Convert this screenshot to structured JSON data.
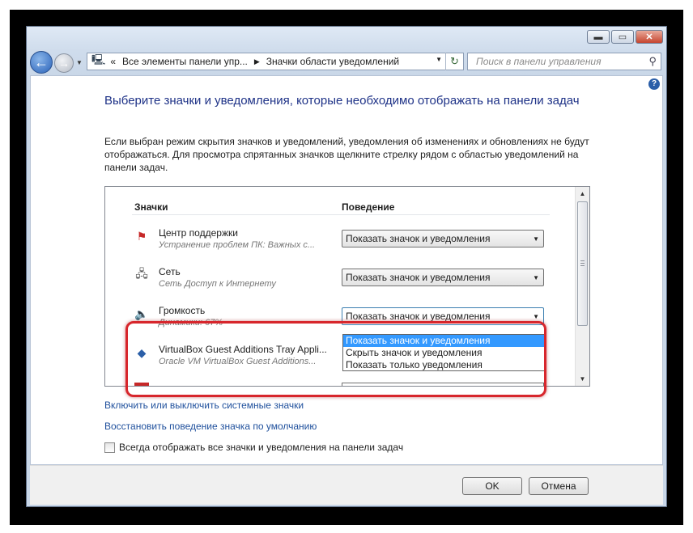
{
  "window": {
    "controls": {
      "minimize": "▬",
      "maximize": "▭",
      "close": "✕"
    }
  },
  "nav": {
    "back": "←",
    "forward": "→",
    "history_drop": "▼",
    "address": {
      "computer_icon": "computer-icon",
      "root_arrow": "«",
      "segment1": "Все элементы панели упр...",
      "sep": "▶",
      "segment2": "Значки области уведомлений",
      "drop": "▼",
      "refresh": "↻"
    },
    "search": {
      "placeholder": "Поиск в панели управления",
      "icon": "⚲"
    }
  },
  "help_icon": "?",
  "heading": "Выберите значки и уведомления, которые необходимо отображать на панели задач",
  "description": "Если выбран режим скрытия значков и уведомлений, уведомления об изменениях и обновлениях не будут отображаться. Для просмотра спрятанных значков щелкните стрелку рядом с областью уведомлений на панели задач.",
  "table": {
    "col_icons": "Значки",
    "col_behavior": "Поведение",
    "rows": [
      {
        "icon": "action-center-icon",
        "glyph": "⚑",
        "name": "Центр поддержки",
        "sub": "Устранение проблем ПК: Важных с...",
        "behavior": "Показать значок и уведомления"
      },
      {
        "icon": "network-icon",
        "glyph": "🖧",
        "name": "Сеть",
        "sub": "Сеть Доступ к Интернету",
        "behavior": "Показать значок и уведомления"
      },
      {
        "icon": "volume-icon",
        "glyph": "🔈",
        "name": "Громкость",
        "sub": "Динамики: 67%",
        "behavior": "Показать значок и уведомления"
      },
      {
        "icon": "virtualbox-icon",
        "glyph": "◆",
        "name": "VirtualBox Guest Additions Tray Appli...",
        "sub": "Oracle VM VirtualBox Guest Additions...",
        "behavior": ""
      }
    ],
    "dropdown_options": [
      "Показать значок и уведомления",
      "Скрыть значок и уведомления",
      "Показать только уведомления"
    ],
    "selected_option": "Показать значок и уведомления"
  },
  "links": {
    "toggle_system": "Включить или выключить системные значки",
    "restore_default": "Восстановить поведение значка по умолчанию"
  },
  "checkbox": {
    "label": "Всегда отображать все значки и уведомления на панели задач",
    "checked": false
  },
  "buttons": {
    "ok": "OK",
    "cancel": "Отмена"
  },
  "colors": {
    "heading": "#1e3287",
    "link": "#1e4f9c",
    "highlight": "#3399ff",
    "annotation": "#d7262c"
  }
}
